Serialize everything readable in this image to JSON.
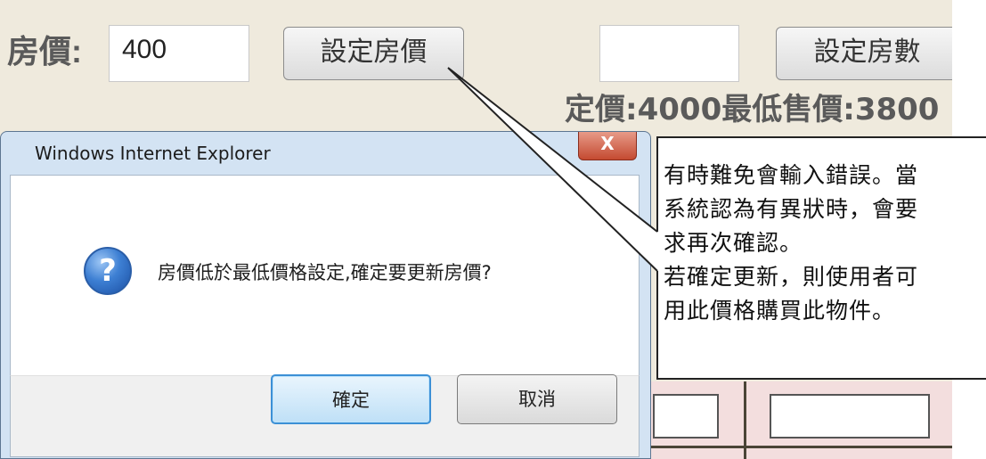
{
  "page": {
    "price_label": "房價:",
    "price_value": "400",
    "set_price_button": "設定房價",
    "rooms_value": "",
    "set_rooms_button": "設定房數",
    "summary": "定價:4000最低售價:3800"
  },
  "dialog": {
    "title": "Windows Internet Explorer",
    "close_glyph": "X",
    "icon_glyph": "?",
    "message": "房價低於最低價格設定,確定要更新房價?",
    "ok_label": "確定",
    "cancel_label": "取消"
  },
  "callout": {
    "lines": [
      "有時難免會輸入錯誤。當",
      "系統認為有異狀時，會要",
      "求再次確認。",
      "若確定更新，則使用者可",
      "用此價格購買此物件。"
    ]
  },
  "colors": {
    "page_bg": "#efeadd",
    "dialog_frame": "#d3e3f3",
    "ok_border": "#3c90d6",
    "close_red": "#c44a31"
  }
}
